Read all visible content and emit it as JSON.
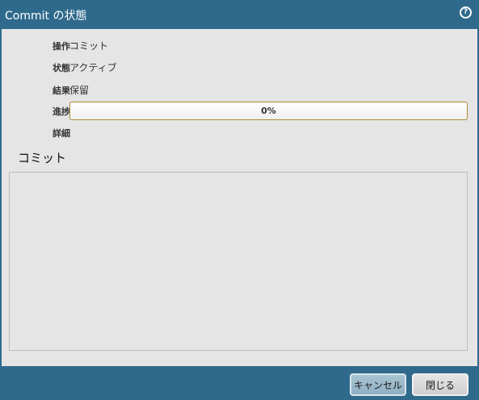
{
  "window": {
    "title": "Commit の状態",
    "help_icon": "help-icon"
  },
  "fields": {
    "operation": {
      "label": "操作",
      "value": "コミット"
    },
    "state": {
      "label": "状態",
      "value": "アクティブ"
    },
    "result": {
      "label": "結果",
      "value": "保留"
    },
    "progress": {
      "label": "進捗",
      "percent": 0,
      "text": "0%"
    },
    "details": {
      "label": "詳細",
      "value": ""
    }
  },
  "commit_section": {
    "title": "コミット"
  },
  "footer": {
    "cancel_label": "キャンセル",
    "close_label": "閉じる"
  },
  "colors": {
    "titlebar": "#2f6a8c",
    "body": "#e5e5e5",
    "progress_border": "#b08a3c"
  }
}
